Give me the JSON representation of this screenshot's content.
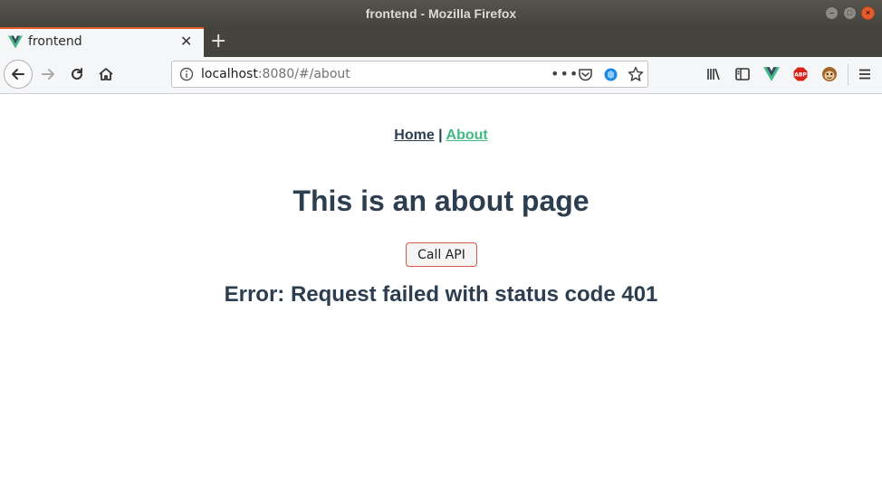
{
  "window": {
    "title": "frontend - Mozilla Firefox",
    "controls": [
      "minimize",
      "maximize",
      "close"
    ]
  },
  "tabs": [
    {
      "title": "frontend",
      "icon": "vue-icon",
      "active": true
    }
  ],
  "toolbar": {
    "url_host": "localhost",
    "url_rest": ":8080/#/about",
    "icons": [
      "back-icon",
      "forward-icon",
      "reload-icon",
      "home-icon",
      "info-icon",
      "more-icon",
      "pocket-icon",
      "extension-icon",
      "bookmark-star-icon",
      "library-icon",
      "sidebar-icon",
      "vue-devtools-icon",
      "adblock-icon",
      "tampermonkey-icon",
      "menu-icon"
    ],
    "adblock_label": "ABP"
  },
  "page": {
    "nav": {
      "home": "Home",
      "separator": "|",
      "about": "About"
    },
    "heading": "This is an about page",
    "button_label": "Call API",
    "error": "Error: Request failed with status code 401"
  },
  "colors": {
    "text": "#2c3e50",
    "active_link": "#42b983",
    "titlebar": "#45433e",
    "tab_accent": "#e35d2c"
  }
}
